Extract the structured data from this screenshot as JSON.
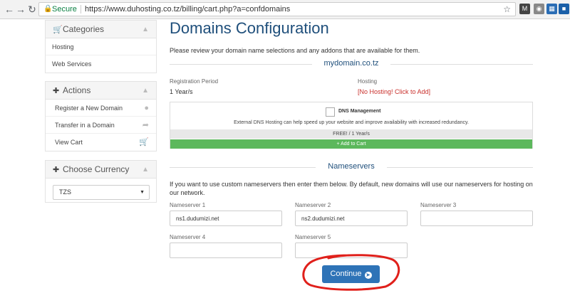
{
  "browser": {
    "secure_label": "Secure",
    "url": "https://www.duhosting.co.tz/billing/cart.php?a=confdomains"
  },
  "sidebar": {
    "categories": {
      "title": "Categories",
      "items": [
        "Hosting",
        "Web Services"
      ]
    },
    "actions": {
      "title": "Actions",
      "items": [
        "Register a New Domain",
        "Transfer in a Domain",
        "View Cart"
      ]
    },
    "currency": {
      "title": "Choose Currency",
      "selected": "TZS"
    }
  },
  "main": {
    "title": "Domains Configuration",
    "intro": "Please review your domain name selections and any addons that are available for them.",
    "domain": "mydomain.co.tz",
    "registration_label": "Registration Period",
    "registration_value": "1 Year/s",
    "hosting_label": "Hosting",
    "hosting_value": "[No Hosting! Click to Add]",
    "addon": {
      "name": "DNS Management",
      "description": "External DNS Hosting can help speed up your website and improve availability with increased redundancy.",
      "price": "FREE! / 1 Year/s",
      "add_label": "+ Add to Cart"
    },
    "nameservers": {
      "title": "Nameservers",
      "intro": "If you want to use custom nameservers then enter them below. By default, new domains will use our nameservers for hosting on our network.",
      "fields": [
        {
          "label": "Nameserver 1",
          "value": "ns1.dudumizi.net"
        },
        {
          "label": "Nameserver 2",
          "value": "ns2.dudumizi.net"
        },
        {
          "label": "Nameserver 3",
          "value": ""
        },
        {
          "label": "Nameserver 4",
          "value": ""
        },
        {
          "label": "Nameserver 5",
          "value": ""
        }
      ]
    },
    "continue_label": "Continue"
  },
  "colors": {
    "title_blue": "#1f4f7b",
    "button_blue": "#2e73b7",
    "add_green": "#5cb85c",
    "hosting_red": "#c9302c",
    "annotation_red": "#e0201b"
  }
}
